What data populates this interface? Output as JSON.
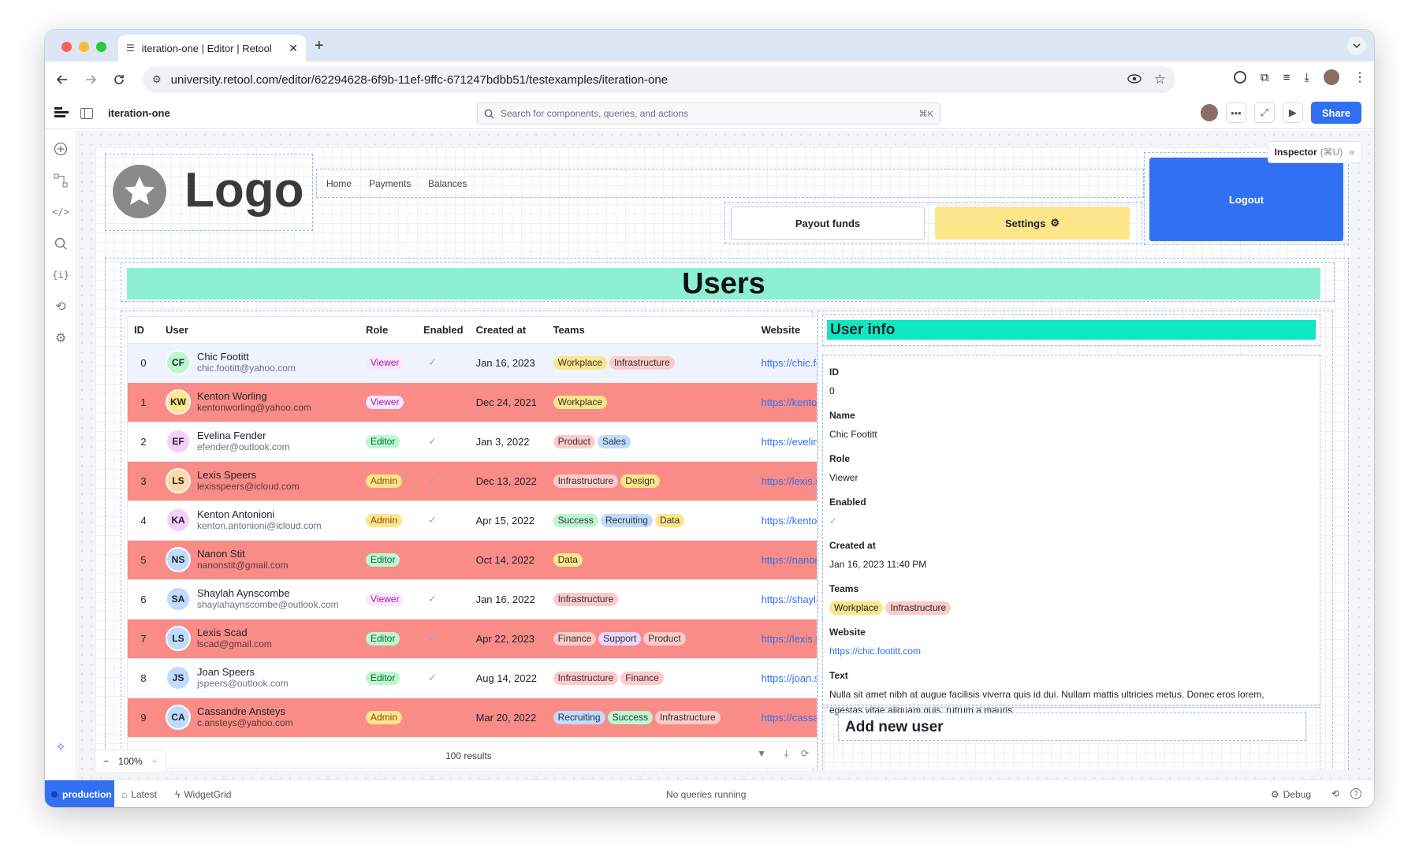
{
  "browser": {
    "tab_title": "iteration-one | Editor | Retool",
    "url": "university.retool.com/editor/62294628-6f9b-11ef-9ffc-671247bdbb51/testexamples/iteration-one"
  },
  "topbar": {
    "app_name": "iteration-one",
    "search_placeholder": "Search for components, queries, and actions",
    "search_shortcut": "⌘K",
    "share_label": "Share"
  },
  "inspector": {
    "label": "Inspector",
    "shortcut": "(⌘U)"
  },
  "header": {
    "logo_text": "Logo",
    "nav": [
      "Home",
      "Payments",
      "Balances"
    ],
    "payout_label": "Payout funds",
    "settings_label": "Settings",
    "logout_label": "Logout"
  },
  "colors": {
    "accent": "#3170f3",
    "banner": "#8df0d2",
    "user_info_bar": "#10e8c3",
    "settings_bg": "#fde68a",
    "row_highlight": "#f98c86",
    "selected_row": "#eef3fd"
  },
  "users_title": "Users",
  "table": {
    "columns": [
      "ID",
      "User",
      "Role",
      "Enabled",
      "Created at",
      "Teams",
      "Website"
    ],
    "rows": [
      {
        "id": "0",
        "initials": "CF",
        "name": "Chic Footitt",
        "email": "chic.footitt@yahoo.com",
        "role": "Viewer",
        "enabled": true,
        "created": "Jan 16, 2023",
        "teams": [
          "Workplace",
          "Infrastructure"
        ],
        "website": "https://chic.footitt.com"
      },
      {
        "id": "1",
        "initials": "KW",
        "name": "Kenton Worling",
        "email": "kentonworling@yahoo.com",
        "role": "Viewer",
        "enabled": false,
        "created": "Dec 24, 2021",
        "teams": [
          "Workplace"
        ],
        "website": "https://kentonworling.com"
      },
      {
        "id": "2",
        "initials": "EF",
        "name": "Evelina Fender",
        "email": "efender@outlook.com",
        "role": "Editor",
        "enabled": true,
        "created": "Jan 3, 2022",
        "teams": [
          "Product",
          "Sales"
        ],
        "website": "https://evelinafender.com"
      },
      {
        "id": "3",
        "initials": "LS",
        "name": "Lexis Speers",
        "email": "lexisspeers@icloud.com",
        "role": "Admin",
        "enabled": true,
        "created": "Dec 13, 2022",
        "teams": [
          "Infrastructure",
          "Design"
        ],
        "website": "https://lexis.speers.com"
      },
      {
        "id": "4",
        "initials": "KA",
        "name": "Kenton Antonioni",
        "email": "kenton.antonioni@icloud.com",
        "role": "Admin",
        "enabled": true,
        "created": "Apr 15, 2022",
        "teams": [
          "Success",
          "Recruiting",
          "Data"
        ],
        "website": "https://kentonantonioni.com"
      },
      {
        "id": "5",
        "initials": "NS",
        "name": "Nanon Stit",
        "email": "nanonstit@gmail.com",
        "role": "Editor",
        "enabled": false,
        "created": "Oct 14, 2022",
        "teams": [
          "Data"
        ],
        "website": "https://nanon.stit.com"
      },
      {
        "id": "6",
        "initials": "SA",
        "name": "Shaylah Aynscombe",
        "email": "shaylahaynscombe@outlook.com",
        "role": "Viewer",
        "enabled": true,
        "created": "Jan 16, 2022",
        "teams": [
          "Infrastructure"
        ],
        "website": "https://shaylahaynscombe.com"
      },
      {
        "id": "7",
        "initials": "LS",
        "name": "Lexis Scad",
        "email": "lscad@gmail.com",
        "role": "Editor",
        "enabled": true,
        "created": "Apr 22, 2023",
        "teams": [
          "Finance",
          "Support",
          "Product"
        ],
        "website": "https://lexis.scad.com"
      },
      {
        "id": "8",
        "initials": "JS",
        "name": "Joan Speers",
        "email": "jspeers@outlook.com",
        "role": "Editor",
        "enabled": true,
        "created": "Aug 14, 2022",
        "teams": [
          "Infrastructure",
          "Finance"
        ],
        "website": "https://joan.speers.com"
      },
      {
        "id": "9",
        "initials": "CA",
        "name": "Cassandre Ansteys",
        "email": "c.ansteys@yahoo.com",
        "role": "Admin",
        "enabled": false,
        "created": "Mar 20, 2022",
        "teams": [
          "Recruiting",
          "Success",
          "Infrastructure"
        ],
        "website": "https://cassandreansteys.com"
      }
    ],
    "results": "100 results"
  },
  "user_info": {
    "title": "User info",
    "fields": {
      "id_label": "ID",
      "id": "0",
      "name_label": "Name",
      "name": "Chic Footitt",
      "role_label": "Role",
      "role": "Viewer",
      "enabled_label": "Enabled",
      "created_label": "Created at",
      "created": "Jan 16, 2023 11:40 PM",
      "teams_label": "Teams",
      "teams": [
        "Workplace",
        "Infrastructure"
      ],
      "website_label": "Website",
      "website": "https://chic.footitt.com",
      "text_label": "Text",
      "text": "Nulla sit amet nibh at augue facilisis viverra quis id dui. Nullam mattis ultricies metus. Donec eros lorem, egestas vitae aliquam quis, rutrum a mauris"
    }
  },
  "add_user_title": "Add new user",
  "zoom": "100%",
  "status": {
    "env": "production",
    "latest": "Latest",
    "widget": "WidgetGrid",
    "queries": "No queries running",
    "debug": "Debug"
  }
}
